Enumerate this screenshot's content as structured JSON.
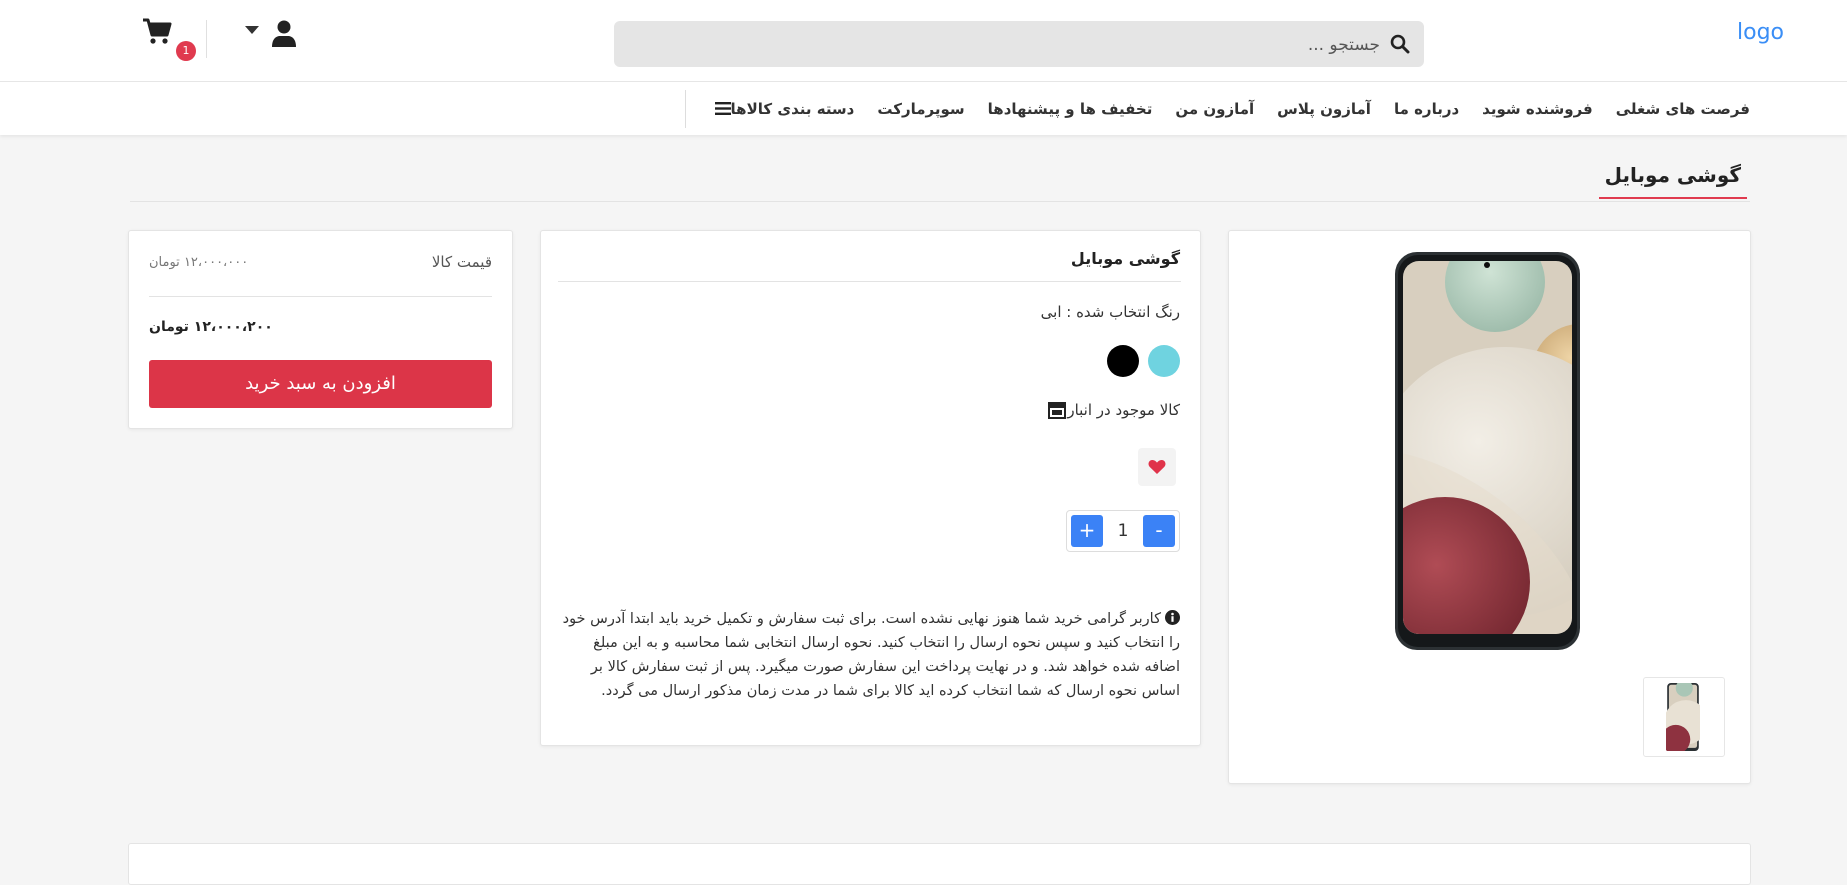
{
  "header": {
    "logo": "logo",
    "search_placeholder": "جستجو ...",
    "cart_count": "1"
  },
  "nav": {
    "categories": "دسته بندی کالاها",
    "items": [
      "سوپرمارکت",
      "تخفیف ها و پیشنهادها",
      "آمازون من",
      "آمازون پلاس",
      "درباره ما",
      "فروشنده شوید",
      "فرصت های شغلی"
    ]
  },
  "page": {
    "section_title": "گوشی موبایل"
  },
  "product": {
    "title": "گوشی موبایل",
    "selected_color": "رنگ انتخاب شده : ابی",
    "colors": [
      "#6fd3e0",
      "#000000"
    ],
    "stock": "کالا موجود در انبار",
    "quantity": "1",
    "notice": "کاربر گرامی خرید شما هنوز نهایی نشده است. برای ثبت سفارش و تکمیل خرید باید ابتدا آدرس خود را انتخاب کنید و سپس نحوه ارسال را انتخاب کنید. نحوه ارسال انتخابی شما محاسبه و به این مبلغ اضافه شده خواهد شد. و در نهایت پرداخت این سفارش صورت میگیرد. پس از ثبت سفارش کالا بر اساس نحوه ارسال که شما انتخاب کرده اید کالا برای شما در مدت زمان مذکور ارسال می گردد."
  },
  "buy": {
    "price_label": "قیمت کالا",
    "old_price": "۱۲،۰۰۰،۰۰۰ تومان",
    "new_price": "۱۲،۰۰۰،۲۰۰ تومان",
    "add_to_cart": "افزودن به سبد خرید"
  },
  "colors": {
    "accent_red": "#dc3548",
    "qty_blue": "#3b82f6",
    "logo_blue": "#3a8ef6"
  }
}
